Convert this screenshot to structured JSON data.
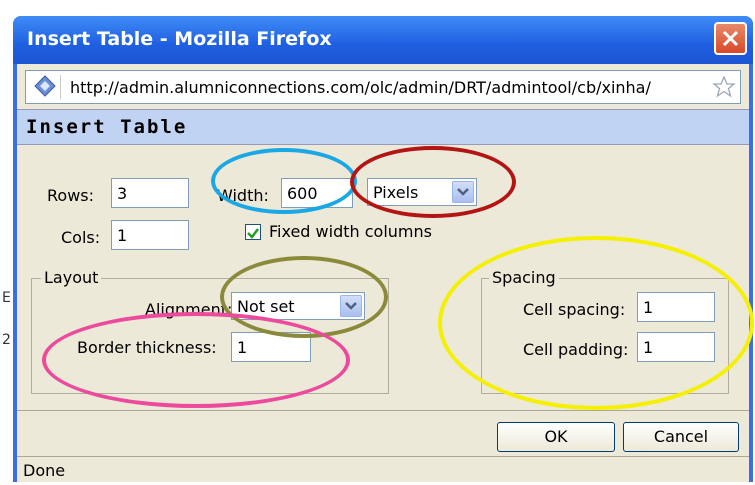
{
  "window": {
    "title": "Insert Table - Mozilla Firefox"
  },
  "urlbar": {
    "url": "http://admin.alumniconnections.com/olc/admin/DRT/admintool/cb/xinha/"
  },
  "dialog": {
    "heading": "Insert Table",
    "rows_label": "Rows:",
    "rows_value": "3",
    "cols_label": "Cols:",
    "cols_value": "1",
    "width_label": "Width:",
    "width_value": "600",
    "units_selected": "Pixels",
    "fixed_width_label": "Fixed width columns",
    "fixed_width_checked": true,
    "layout": {
      "legend": "Layout",
      "alignment_label": "Alignment:",
      "alignment_value": "Not set",
      "border_label": "Border thickness:",
      "border_value": "1"
    },
    "spacing": {
      "legend": "Spacing",
      "cell_spacing_label": "Cell spacing:",
      "cell_spacing_value": "1",
      "cell_padding_label": "Cell padding:",
      "cell_padding_value": "1"
    },
    "ok_label": "OK",
    "cancel_label": "Cancel"
  },
  "status": {
    "text": "Done"
  },
  "annotations": {
    "colors": [
      "#1aa7e6",
      "#b31414",
      "#8a8a3a",
      "#ec4a9c",
      "#f4f000"
    ]
  },
  "colors": {
    "titlebar": "#2460e0",
    "heading_bg": "#c0d3f2",
    "dialog_bg": "#ece9d8",
    "checkmark": "#21a121"
  }
}
